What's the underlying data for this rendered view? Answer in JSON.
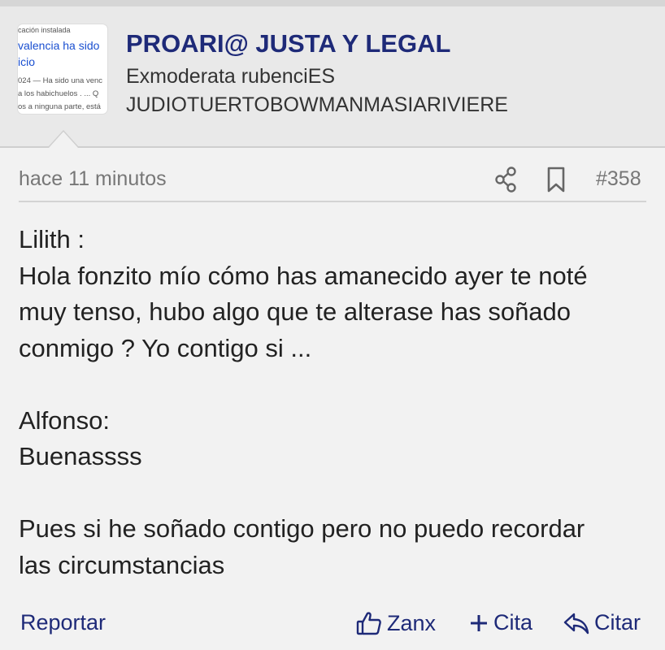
{
  "header": {
    "title": "PROARI@ JUSTA Y LEGAL",
    "subtitle_line1": "Exmoderata rubenciES",
    "subtitle_line2": "JUDIOTUERTOBOWMANMASIARIVIERE",
    "avatar_lines": [
      "cación instalada",
      "valencia ha sido",
      "icio",
      "024 — Ha sido una venc",
      "a los habichuelos . ... Q",
      "os a ninguna parte, está"
    ]
  },
  "post": {
    "time": "hace 11 minutos",
    "number": "#358",
    "icons": {
      "share": "share-icon",
      "bookmark": "bookmark-icon"
    },
    "lines": [
      "Lilith :",
      "Hola fonzito mío cómo has amanecido ayer te noté",
      "muy tenso, hubo algo que te alterase has soñado",
      "conmigo ? Yo contigo si ...",
      "",
      "Alfonso:",
      "Buenassss",
      "",
      "Pues si he soñado contigo pero no puedo recordar",
      "las circumstancias"
    ]
  },
  "footer": {
    "report_label": "Reportar",
    "like_label": "Zanx",
    "quote_plus_label": "Cita",
    "reply_label": "Citar"
  },
  "colors": {
    "accent": "#1e2a78",
    "background": "#f2f2f2",
    "header_bg": "#e9e9e9",
    "muted_text": "#777777"
  }
}
